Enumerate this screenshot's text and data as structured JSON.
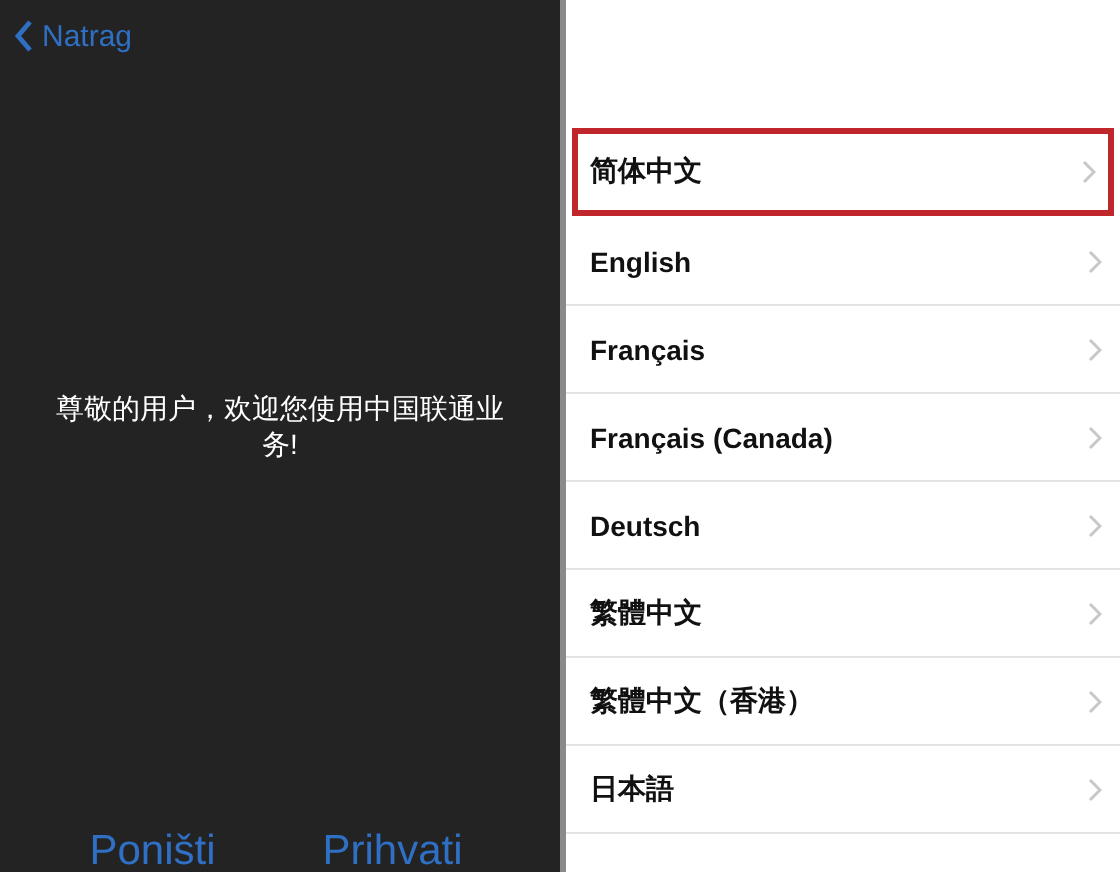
{
  "left_screen": {
    "back_button": {
      "label": "Natrag"
    },
    "alert_message": "尊敬的用户，欢迎您使用中国联通业务!",
    "buttons": [
      {
        "label": "Poništi"
      },
      {
        "label": "Prihvati"
      }
    ]
  },
  "language_list": {
    "items": [
      {
        "label": "简体中文",
        "selected": true
      },
      {
        "label": "English",
        "selected": false
      },
      {
        "label": "Français",
        "selected": false
      },
      {
        "label": "Français (Canada)",
        "selected": false
      },
      {
        "label": "Deutsch",
        "selected": false
      },
      {
        "label": "繁體中文",
        "selected": false
      },
      {
        "label": "繁體中文（香港）",
        "selected": false
      },
      {
        "label": "日本語",
        "selected": false
      }
    ]
  }
}
